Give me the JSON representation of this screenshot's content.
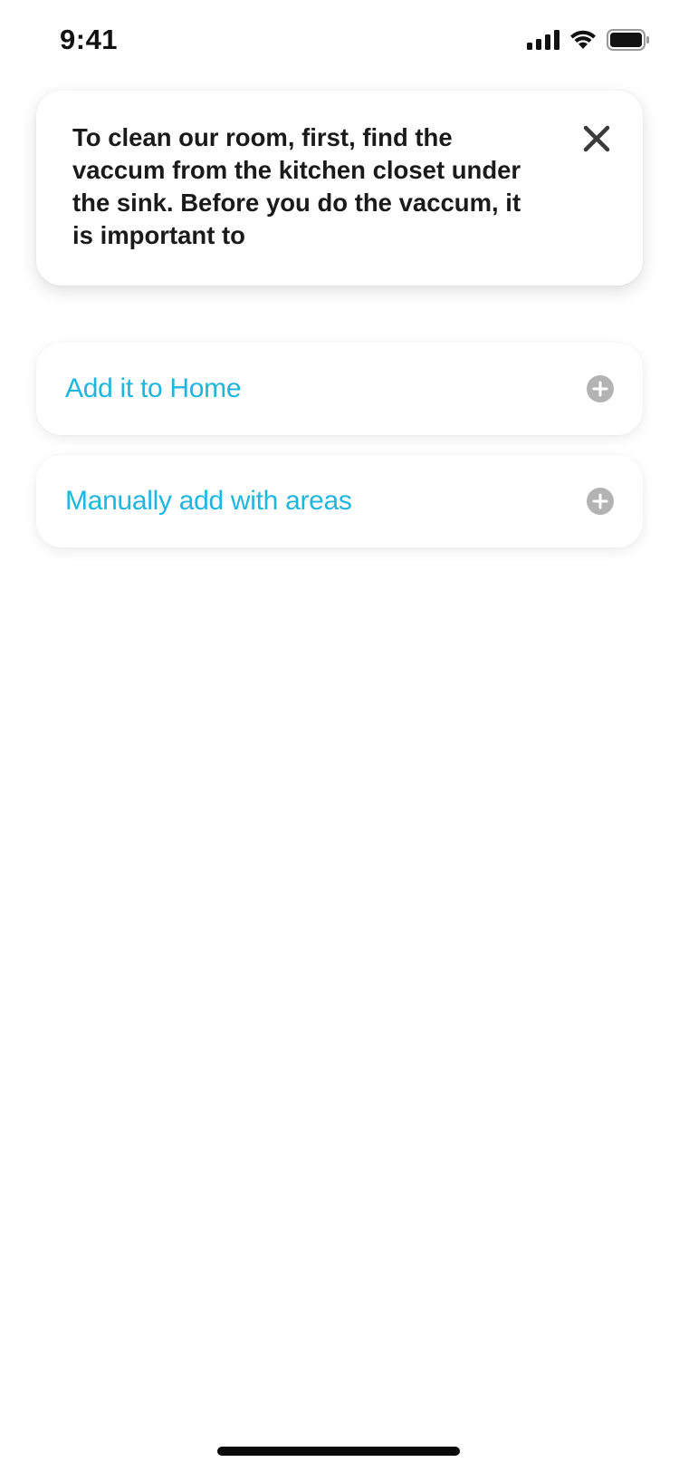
{
  "status_bar": {
    "time": "9:41",
    "icons": [
      "cellular-signal-icon",
      "wifi-icon",
      "battery-icon"
    ]
  },
  "note": {
    "text": "To clean our room, first, find the vaccum from the kitchen closet under the sink. Before you do the vaccum, it is important to",
    "close_icon": "close-icon"
  },
  "options": [
    {
      "label": "Add it to Home",
      "icon": "plus-circle-icon"
    },
    {
      "label": "Manually add with areas",
      "icon": "plus-circle-icon"
    }
  ],
  "colors": {
    "accent": "#1fb6de",
    "icon_gray": "#b3b3b3",
    "text_dark": "#1a1a1a"
  }
}
